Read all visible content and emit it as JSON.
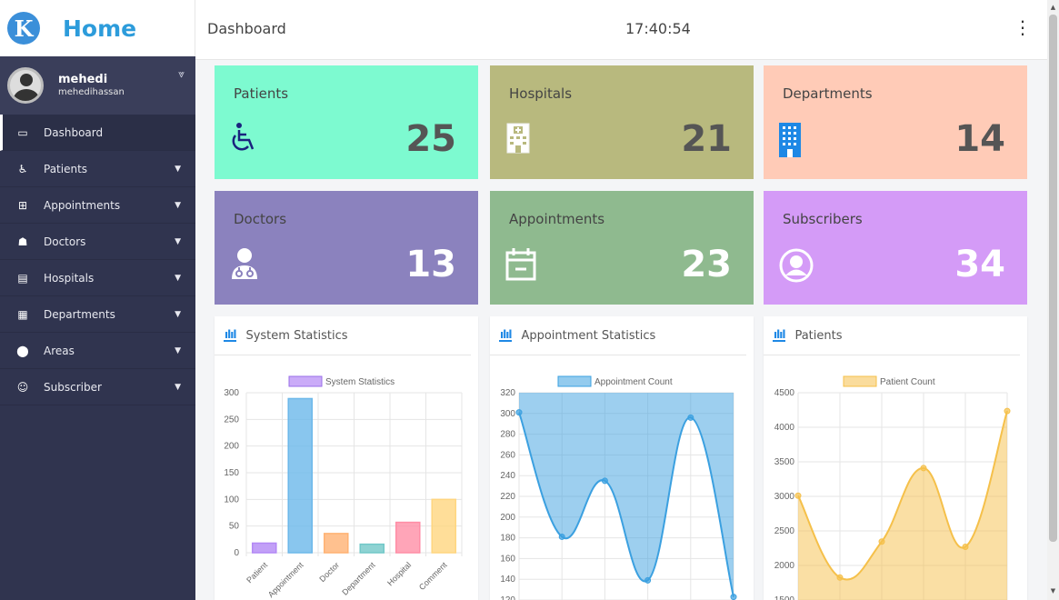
{
  "brand": {
    "logo_letter": "K",
    "title": "Home"
  },
  "user": {
    "name": "mehedi",
    "handle": "mehedihassan"
  },
  "nav": [
    {
      "label": "Dashboard",
      "icon": "monitor-icon",
      "glyph": "▭",
      "active": true
    },
    {
      "label": "Patients",
      "icon": "wheelchair-icon",
      "glyph": "♿"
    },
    {
      "label": "Appointments",
      "icon": "calendar-plus-icon",
      "glyph": "⊞"
    },
    {
      "label": "Doctors",
      "icon": "doctor-icon",
      "glyph": "☗"
    },
    {
      "label": "Hospitals",
      "icon": "hospital-icon",
      "glyph": "▤"
    },
    {
      "label": "Departments",
      "icon": "building-icon",
      "glyph": "▦"
    },
    {
      "label": "Areas",
      "icon": "map-marker-icon",
      "glyph": "⬤"
    },
    {
      "label": "Subscriber",
      "icon": "users-icon",
      "glyph": "☺"
    }
  ],
  "topbar": {
    "title": "Dashboard",
    "time": "17:40:54"
  },
  "cards": [
    {
      "title": "Patients",
      "value": "25",
      "icon": "wheelchair-icon",
      "color": "#7dfad0"
    },
    {
      "title": "Hospitals",
      "value": "21",
      "icon": "hospital-icon",
      "color": "#b8b97e"
    },
    {
      "title": "Departments",
      "value": "14",
      "icon": "building-icon",
      "color": "#ffcbb7"
    },
    {
      "title": "Doctors",
      "value": "13",
      "icon": "doctor-icon",
      "color": "#8b82be"
    },
    {
      "title": "Appointments",
      "value": "23",
      "icon": "calendar-icon",
      "color": "#8fba8f"
    },
    {
      "title": "Subscribers",
      "value": "34",
      "icon": "user-circle-icon",
      "color": "#d49bf7"
    }
  ],
  "panels": {
    "system": "System Statistics",
    "appointment": "Appointment Statistics",
    "patients": "Patients"
  },
  "chart_data": [
    {
      "type": "bar",
      "title": "System Statistics",
      "legend": "System Statistics",
      "categories": [
        "Patient",
        "Appointment",
        "Doctor",
        "Department",
        "Hospital",
        "Comment"
      ],
      "values": [
        18,
        289,
        36,
        16,
        57,
        100
      ],
      "colors": [
        "#b388f5",
        "#6cb8ea",
        "#ffb273",
        "#72c8c8",
        "#ff8ea6",
        "#ffd680"
      ],
      "ylim": [
        0,
        300
      ],
      "yticks": [
        0,
        50,
        100,
        150,
        200,
        250,
        300
      ]
    },
    {
      "type": "area",
      "title": "Appointment Statistics",
      "legend": "Appointment Count",
      "x": [
        0,
        1,
        2,
        3,
        4,
        5
      ],
      "values": [
        301,
        181,
        235,
        139,
        296,
        123
      ],
      "color": "#3ba0e0",
      "ylim": [
        120,
        320
      ],
      "yticks": [
        120,
        140,
        160,
        180,
        200,
        220,
        240,
        260,
        280,
        300,
        320
      ]
    },
    {
      "type": "area",
      "title": "Patients",
      "legend": "Patient Count",
      "x": [
        0,
        1,
        2,
        3,
        4,
        5
      ],
      "values": [
        3010,
        1825,
        2345,
        3410,
        2270,
        4235
      ],
      "color": "#f5c04a",
      "ylim": [
        1500,
        4500
      ],
      "yticks": [
        1500,
        2000,
        2500,
        3000,
        3500,
        4000,
        4500
      ]
    }
  ]
}
